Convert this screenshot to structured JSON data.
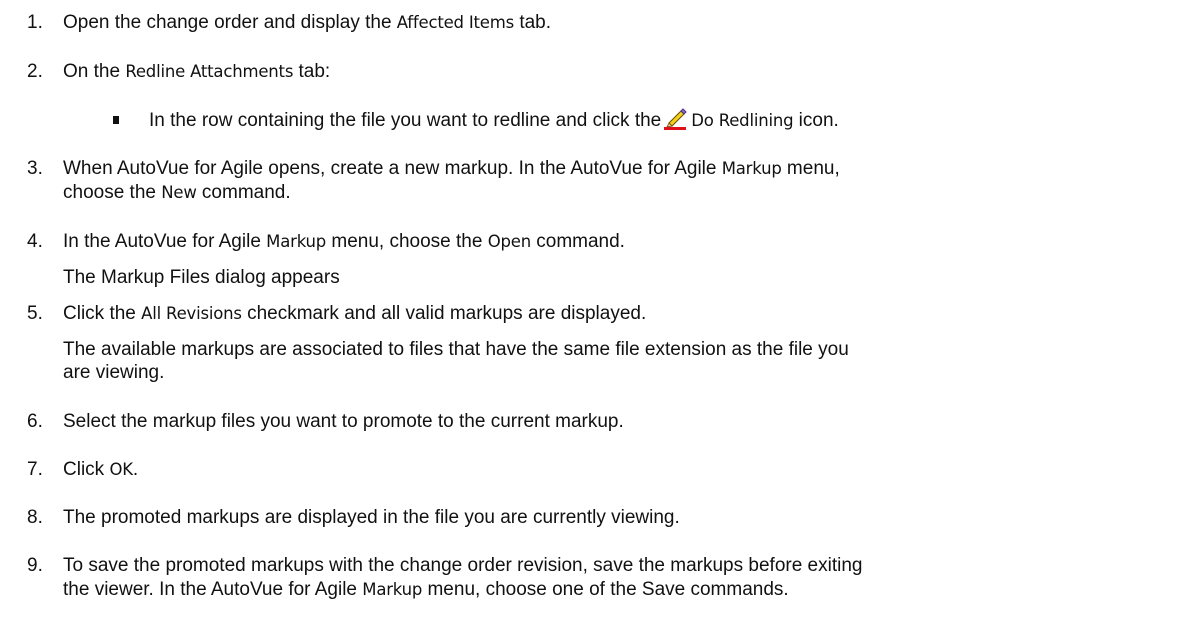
{
  "steps": [
    {
      "num": "1.",
      "pre": "Open the change order and display the ",
      "ui": "Affected Items",
      "post": " tab."
    },
    {
      "num": "2.",
      "pre": "On the ",
      "ui": "Redline Attachments",
      "post": " tab:",
      "bullet": {
        "pre": "In the row containing the file you want to redline and click the",
        "ui": "Do Redlining",
        "post": " icon.",
        "icon": "pencil-redline-icon"
      }
    },
    {
      "num": "3.",
      "line1": {
        "pre": "When AutoVue for Agile opens, create a new markup. In the AutoVue for Agile ",
        "ui": "Markup",
        "post": " menu,"
      },
      "line2": {
        "pre": "choose the ",
        "ui": "New",
        "post": " command."
      }
    },
    {
      "num": "4.",
      "pre": "In the AutoVue for Agile ",
      "ui": "Markup",
      "post": " menu, choose the ",
      "ui2": "Open",
      "post2": " command.",
      "note": "The Markup Files dialog appears"
    },
    {
      "num": "5.",
      "pre": "Click the ",
      "ui": "All Revisions",
      "post": " checkmark and all valid markups are displayed.",
      "note1": "The available markups are associated to files that have the same file extension as the file you",
      "note2": "are viewing."
    },
    {
      "num": "6.",
      "text": "Select the markup files you want to promote to the current markup."
    },
    {
      "num": "7.",
      "pre": "Click ",
      "ui": "OK",
      "post": "."
    },
    {
      "num": "8.",
      "text": "The promoted markups are displayed in the file you are currently viewing."
    },
    {
      "num": "9.",
      "line1": "To save the promoted markups with the change order revision, save the markups before exiting",
      "line2": {
        "pre": "the viewer. In the AutoVue for Agile ",
        "ui": "Markup",
        "post": " menu, choose one of the Save commands."
      }
    }
  ]
}
